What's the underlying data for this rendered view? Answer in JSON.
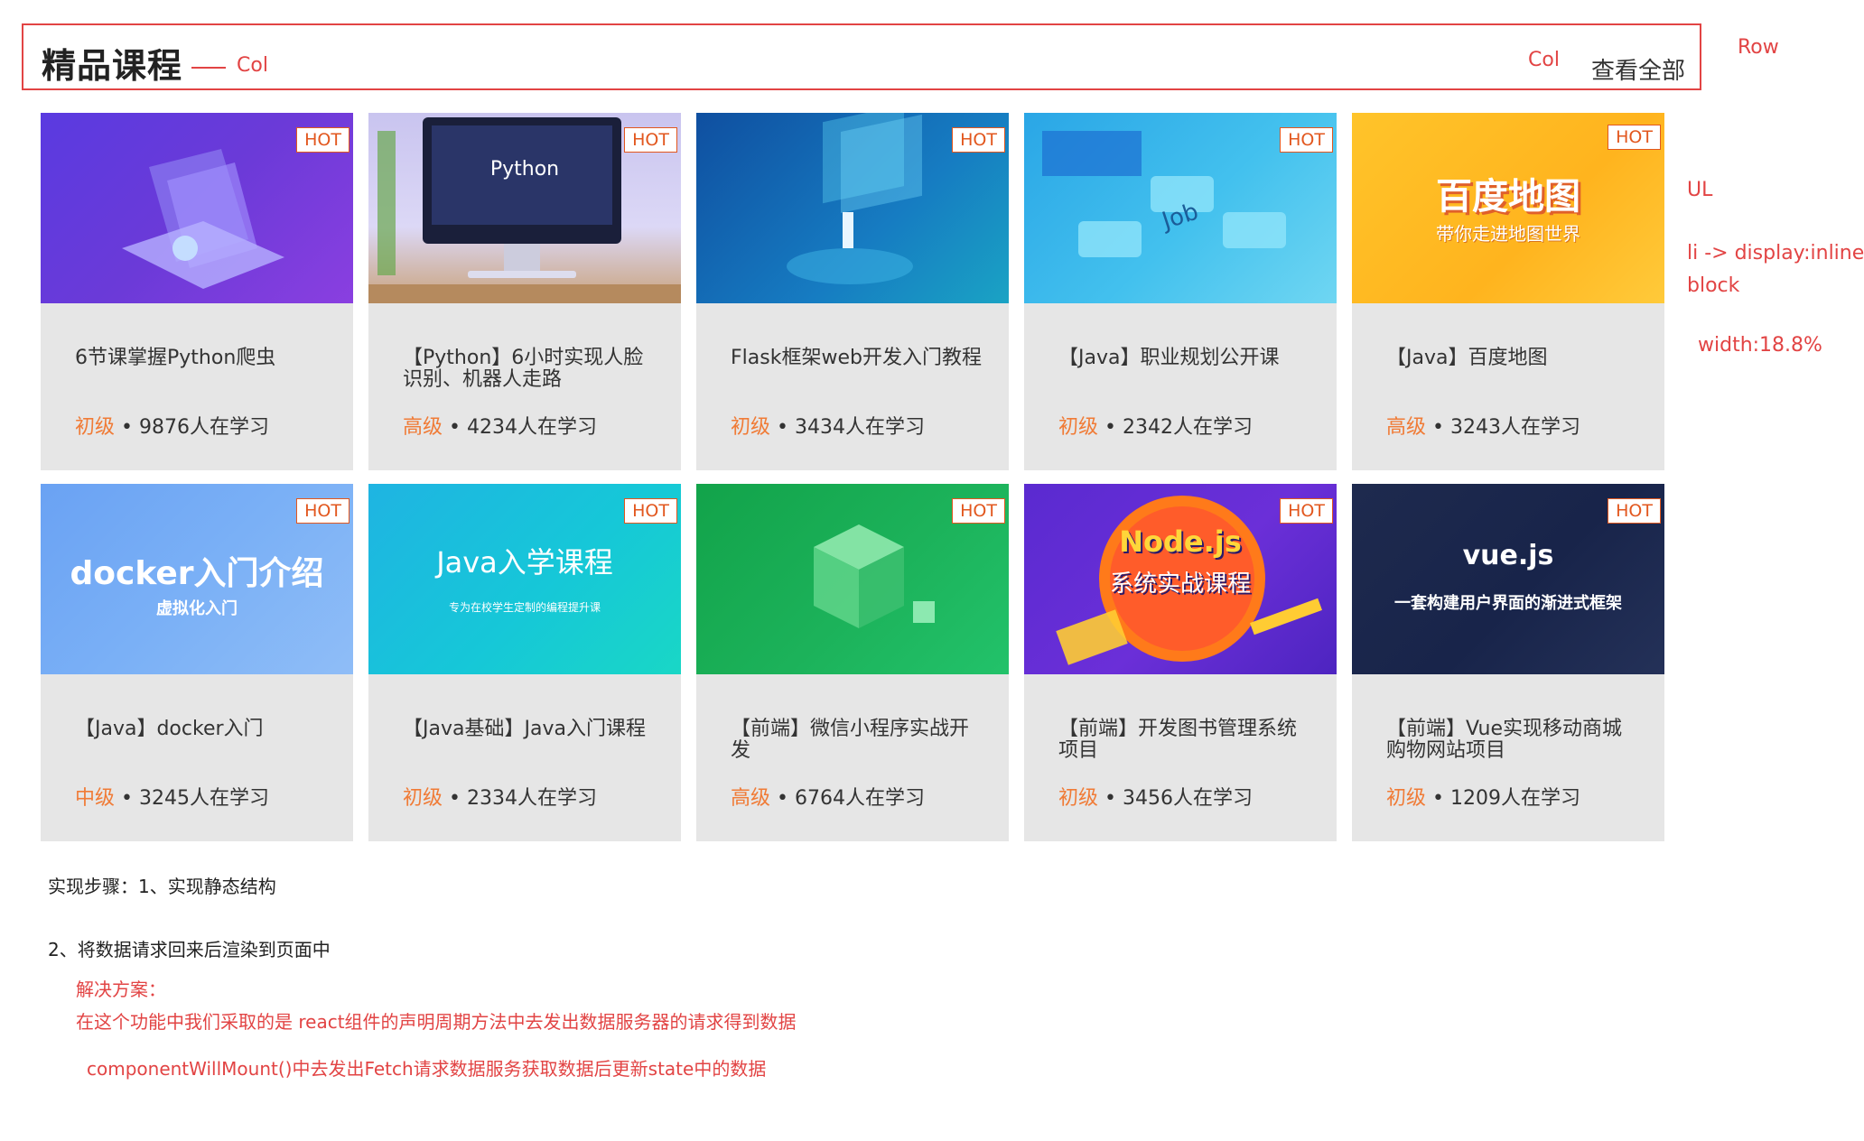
{
  "header": {
    "title": "精品课程",
    "col_left": "Col",
    "col_right": "Col",
    "view_all": "查看全部"
  },
  "annotations": {
    "row": "Row",
    "ul": "UL",
    "li_1": "li -> display:inline-",
    "li_2": "block",
    "width": "width:18.8%"
  },
  "hot_label": "HOT",
  "courses": [
    {
      "title": "6节课掌握Python爬虫",
      "level": "初级",
      "learners": "• 9876人在学习",
      "thumb_text": "",
      "thumb_sub": ""
    },
    {
      "title": "【Python】6小时实现人脸识别、机器人走路",
      "level": "高级",
      "learners": "• 4234人在学习",
      "thumb_text": "Python",
      "thumb_sub": ""
    },
    {
      "title": "Flask框架web开发入门教程",
      "level": "初级",
      "learners": "• 3434人在学习",
      "thumb_text": "",
      "thumb_sub": ""
    },
    {
      "title": "【Java】职业规划公开课",
      "level": "初级",
      "learners": "• 2342人在学习",
      "thumb_text": "Job",
      "thumb_sub": ""
    },
    {
      "title": "【Java】百度地图",
      "level": "高级",
      "learners": "• 3243人在学习",
      "thumb_text": "百度地图",
      "thumb_sub": "带你走进地图世界"
    },
    {
      "title": "【Java】docker入门",
      "level": "中级",
      "learners": "• 3245人在学习",
      "thumb_text": "docker入门介绍",
      "thumb_sub": "虚拟化入门"
    },
    {
      "title": "【Java基础】Java入门课程",
      "level": "初级",
      "learners": "• 2334人在学习",
      "thumb_text": "Java入学课程",
      "thumb_sub": "专为在校学生定制的编程提升课"
    },
    {
      "title": "【前端】微信小程序实战开发",
      "level": "高级",
      "learners": "• 6764人在学习",
      "thumb_text": "",
      "thumb_sub": ""
    },
    {
      "title": "【前端】开发图书管理系统项目",
      "level": "初级",
      "learners": "• 3456人在学习",
      "thumb_text": "Node.js",
      "thumb_sub": "系统实战课程"
    },
    {
      "title": "【前端】Vue实现移动商城购物网站项目",
      "level": "初级",
      "learners": "• 1209人在学习",
      "thumb_text": "vue.js",
      "thumb_sub": "一套构建用户界面的渐进式框架"
    }
  ],
  "steps": {
    "step1": "实现步骤：1、实现静态结构",
    "step2": "2、将数据请求回来后渲染到页面中",
    "solution_label": "解决方案：",
    "solution_text": "在这个功能中我们采取的是 react组件的声明周期方法中去发出数据服务器的请求得到数据",
    "solution_detail": "componentWillMount()中去发出Fetch请求数据服务获取数据后更新state中的数据"
  },
  "colors": {
    "accent_red": "#e24444",
    "hot_orange": "#e2571e",
    "level_orange": "#f07b36",
    "card_bg": "#e6e6e6"
  }
}
